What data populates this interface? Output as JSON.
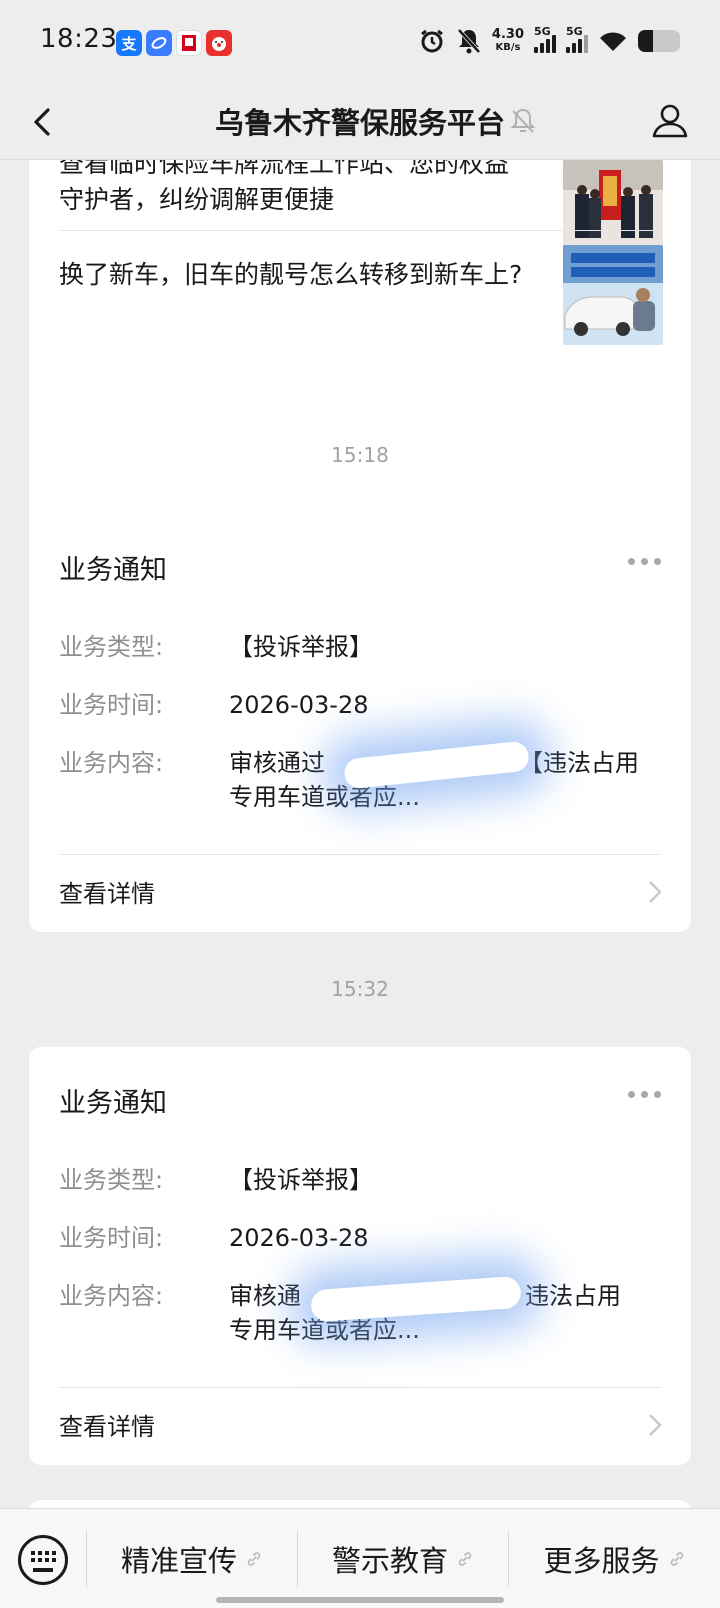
{
  "status_bar": {
    "time": "18:23",
    "net_speed_value": "4.30",
    "net_speed_unit": "KB/s",
    "sim1": "5G",
    "sim2": "5G",
    "battery_level": 0.35
  },
  "nav": {
    "title": "乌鲁木齐警保服务平台"
  },
  "articles": [
    {
      "title": "查看临时保险车牌流程工作站、您的权益守护者，纠纷调解更便捷"
    },
    {
      "title": "换了新车，旧车的靓号怎么转移到新车上?"
    }
  ],
  "timestamps": [
    "15:18",
    "15:32"
  ],
  "notices": [
    {
      "title": "业务通知",
      "type_label": "业务类型:",
      "type_value": "【投诉举报】",
      "time_label": "业务时间:",
      "time_value": "2026-03-28",
      "content_label": "业务内容:",
      "content_value_start": "审核通过",
      "content_value_end": "【违法占用",
      "content_value_line2": "专用车道或者应...",
      "detail_label": "查看详情"
    },
    {
      "title": "业务通知",
      "type_label": "业务类型:",
      "type_value": "【投诉举报】",
      "time_label": "业务时间:",
      "time_value": "2026-03-28",
      "content_label": "业务内容:",
      "content_value_start": "审核通",
      "content_value_end": "违法占用",
      "content_value_line2": "专用车道或者应...",
      "detail_label": "查看详情"
    }
  ],
  "menu": {
    "items": [
      "精准宣传",
      "警示教育",
      "更多服务"
    ]
  }
}
